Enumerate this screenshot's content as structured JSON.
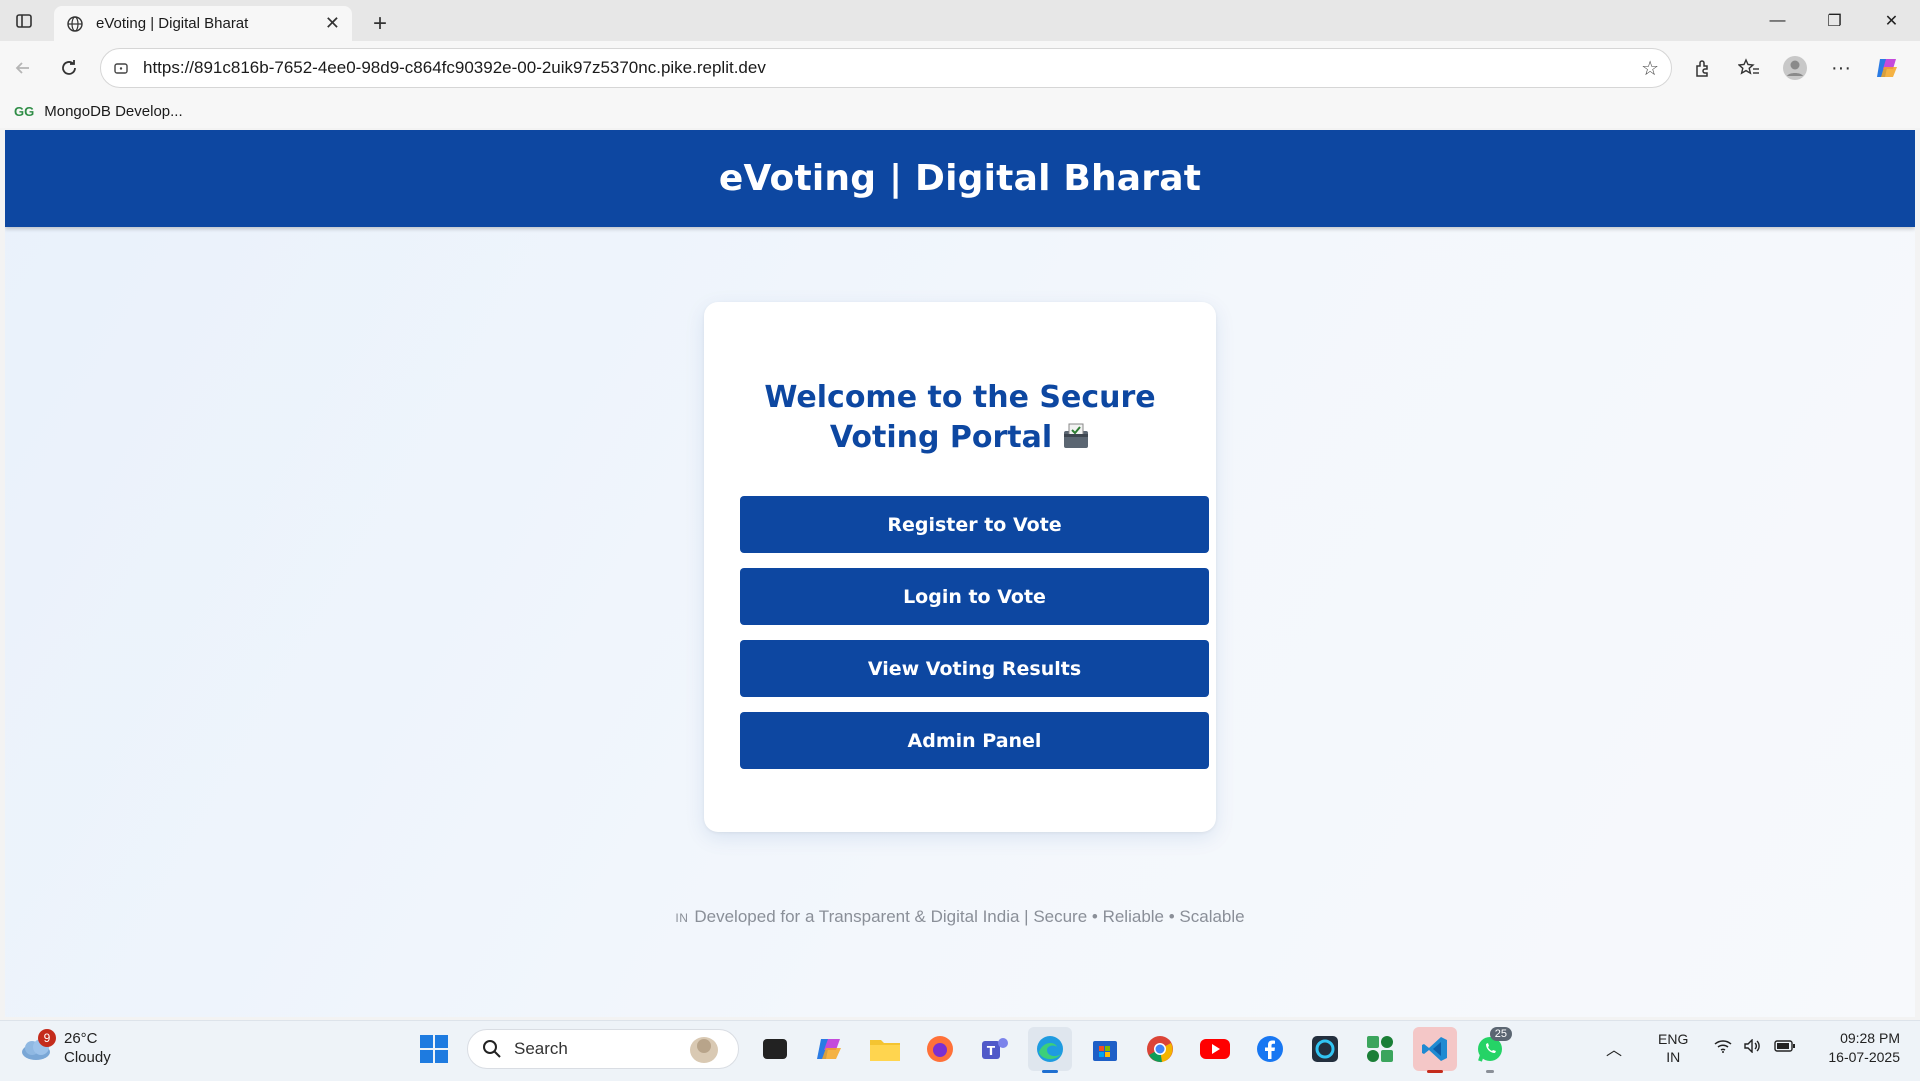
{
  "browser": {
    "tab_title": "eVoting | Digital Bharat",
    "url": "https://891c816b-7652-4ee0-98d9-c864fc90392e-00-2uik97z5370nc.pike.replit.dev",
    "bookmark_label": "MongoDB Develop...",
    "bookmark_icon_text": "GG"
  },
  "site": {
    "header_title": "eVoting | Digital Bharat",
    "welcome_title": "Welcome to the Secure Voting Portal",
    "buttons": {
      "register": "Register to Vote",
      "login": "Login to Vote",
      "results": "View Voting Results",
      "admin": "Admin Panel"
    },
    "footer_flag": "IN",
    "footer_text": "Developed for a Transparent & Digital India | Secure • Reliable • Scalable",
    "brand_color": "#0d47a1"
  },
  "taskbar": {
    "weather_badge": "9",
    "temperature": "26°C",
    "condition": "Cloudy",
    "search_placeholder": "Search",
    "whatsapp_badge": "25",
    "lang_primary": "ENG",
    "lang_region": "IN",
    "time": "09:28 PM",
    "date": "16-07-2025"
  }
}
